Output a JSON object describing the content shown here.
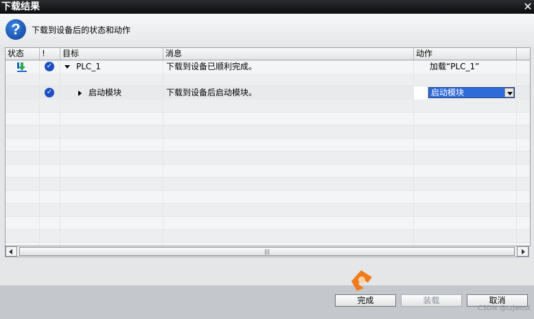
{
  "window": {
    "title": "下载结果",
    "header_message": "下载到设备后的状态和动作"
  },
  "table": {
    "columns": [
      "状态",
      "!",
      "目标",
      "消息",
      "动作"
    ],
    "rows": [
      {
        "status_icon": "download-icon",
        "flag_icon": "check-icon",
        "target": "PLC_1",
        "expander": "expanded",
        "message": "下载到设备已顺利完成。",
        "action": "加载“PLC_1”"
      },
      {
        "status_icon": "",
        "flag_icon": "check-icon",
        "target": "启动模块",
        "expander": "collapsed",
        "message": "下载到设备后启动模块。",
        "action_select": "启动模块"
      }
    ],
    "scroll_grip": "|||"
  },
  "buttons": {
    "finish": "完成",
    "load": "装载",
    "cancel": "取消"
  },
  "watermark": "CSDN @tzjwest",
  "colors": {
    "selection": "#2f6bd8",
    "status_ok": "#1e4fc2",
    "logo": "#f07b1a"
  }
}
